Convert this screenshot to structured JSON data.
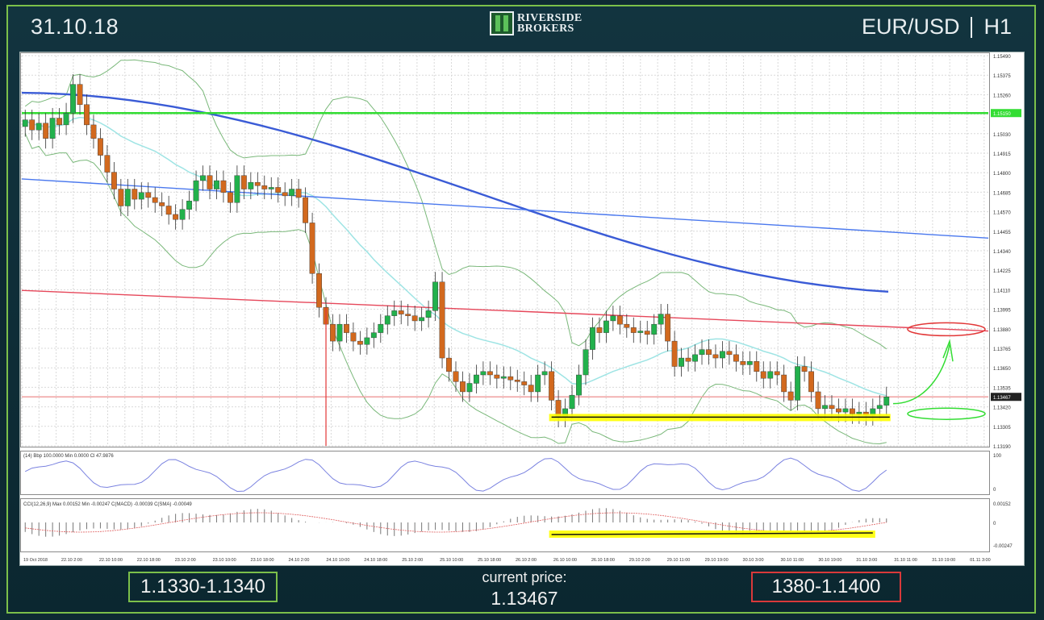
{
  "header": {
    "date": "31.10.18",
    "brand_line1": "RIVERSIDE",
    "brand_line2": "BROKERS",
    "pair": "EUR/USD",
    "timeframe": "H1"
  },
  "footer": {
    "support_range": "1.1330-1.1340",
    "current_label": "current price:",
    "current_value": "1.13467",
    "resistance_range": "1380-1.1400"
  },
  "colors": {
    "support": "#7cc04a",
    "resistance": "#d9393a",
    "bull": "#22b14c",
    "bear": "#d2691e",
    "ma_long": "#3a5bd6",
    "bands": "#7ab87a",
    "mid": "#9ee4e4",
    "highlight": "#ffff00"
  },
  "chart_data": {
    "type": "candlestick",
    "ylim": [
      1.1318,
      1.1549
    ],
    "price_ticks": [
      "1.15490",
      "1.15375",
      "1.15260",
      "1.15150",
      "1.15030",
      "1.14915",
      "1.14800",
      "1.14685",
      "1.14570",
      "1.14455",
      "1.14340",
      "1.14225",
      "1.14110",
      "1.13995",
      "1.13880",
      "1.13765",
      "1.13650",
      "1.13535",
      "1.13420",
      "1.13305",
      "1.13190"
    ],
    "hline_green": 1.1515,
    "hline_green_label": "1.15150",
    "hline_red": 1.1347,
    "current_label": "1.13467",
    "close": [
      1.1511,
      1.1505,
      1.1509,
      1.15,
      1.1512,
      1.1508,
      1.1515,
      1.1532,
      1.152,
      1.1508,
      1.15,
      1.149,
      1.148,
      1.147,
      1.146,
      1.147,
      1.1464,
      1.1468,
      1.1465,
      1.1462,
      1.146,
      1.1455,
      1.1452,
      1.1458,
      1.1463,
      1.1475,
      1.1478,
      1.147,
      1.1475,
      1.1468,
      1.1462,
      1.1478,
      1.147,
      1.1474,
      1.1472,
      1.147,
      1.1471,
      1.1468,
      1.1466,
      1.147,
      1.1465,
      1.145,
      1.142,
      1.14,
      1.139,
      1.138,
      1.139,
      1.1385,
      1.138,
      1.1378,
      1.1382,
      1.1385,
      1.139,
      1.1395,
      1.1398,
      1.1396,
      1.1395,
      1.1392,
      1.1394,
      1.1398,
      1.1415,
      1.137,
      1.1362,
      1.1356,
      1.135,
      1.1355,
      1.136,
      1.1362,
      1.136,
      1.1358,
      1.1359,
      1.1357,
      1.1356,
      1.1354,
      1.135,
      1.136,
      1.1362,
      1.1345,
      1.1335,
      1.134,
      1.1348,
      1.136,
      1.1375,
      1.1388,
      1.1385,
      1.1392,
      1.1395,
      1.139,
      1.1388,
      1.1385,
      1.1386,
      1.1384,
      1.139,
      1.1396,
      1.138,
      1.1365,
      1.137,
      1.1368,
      1.1372,
      1.1375,
      1.1372,
      1.137,
      1.1374,
      1.1372,
      1.1368,
      1.1366,
      1.1368,
      1.1362,
      1.1358,
      1.1362,
      1.136,
      1.135,
      1.1345,
      1.1365,
      1.1362,
      1.135,
      1.134,
      1.1342,
      1.134,
      1.1338,
      1.134,
      1.1337,
      1.1338,
      1.1336,
      1.134,
      1.1342,
      1.1347
    ],
    "ma_long_start": 1.1527,
    "ma_long_end": 1.1412,
    "trend_blue": [
      1.1476,
      1.1441
    ],
    "trend_red": [
      1.141,
      1.1386
    ],
    "x_labels": [
      "19 Oct 2018",
      "22.10 2:00",
      "22.10 10:00",
      "22.10 18:00",
      "23.10 2:00",
      "23.10 10:00",
      "23.10 18:00",
      "24.10 2:00",
      "24.10 10:00",
      "24.10 18:00",
      "25.10 2:00",
      "25.10 10:00",
      "25.10 18:00",
      "26.10 2:00",
      "26.10 10:00",
      "26.10 18:00",
      "29.10 2:00",
      "29.10 11:00",
      "29.10 19:00",
      "30.10 3:00",
      "30.10 11:00",
      "30.10 19:00",
      "31.10 3:00",
      "31.10 11:00",
      "31.10 19:00",
      "01.11 3:00"
    ],
    "osc1_label": "(14) Bbp 100.0000 Min 0.0000 Cl 47.9876",
    "osc1_ticks": [
      "100",
      "0"
    ],
    "osc2_label": "CCI(12,26,9) Max 0.00152 Min -0.00247 C(MACD) -0.00039 C(SMA) -0.00049",
    "osc2_ticks": [
      "0.00152",
      "0",
      "-0.00247"
    ]
  }
}
